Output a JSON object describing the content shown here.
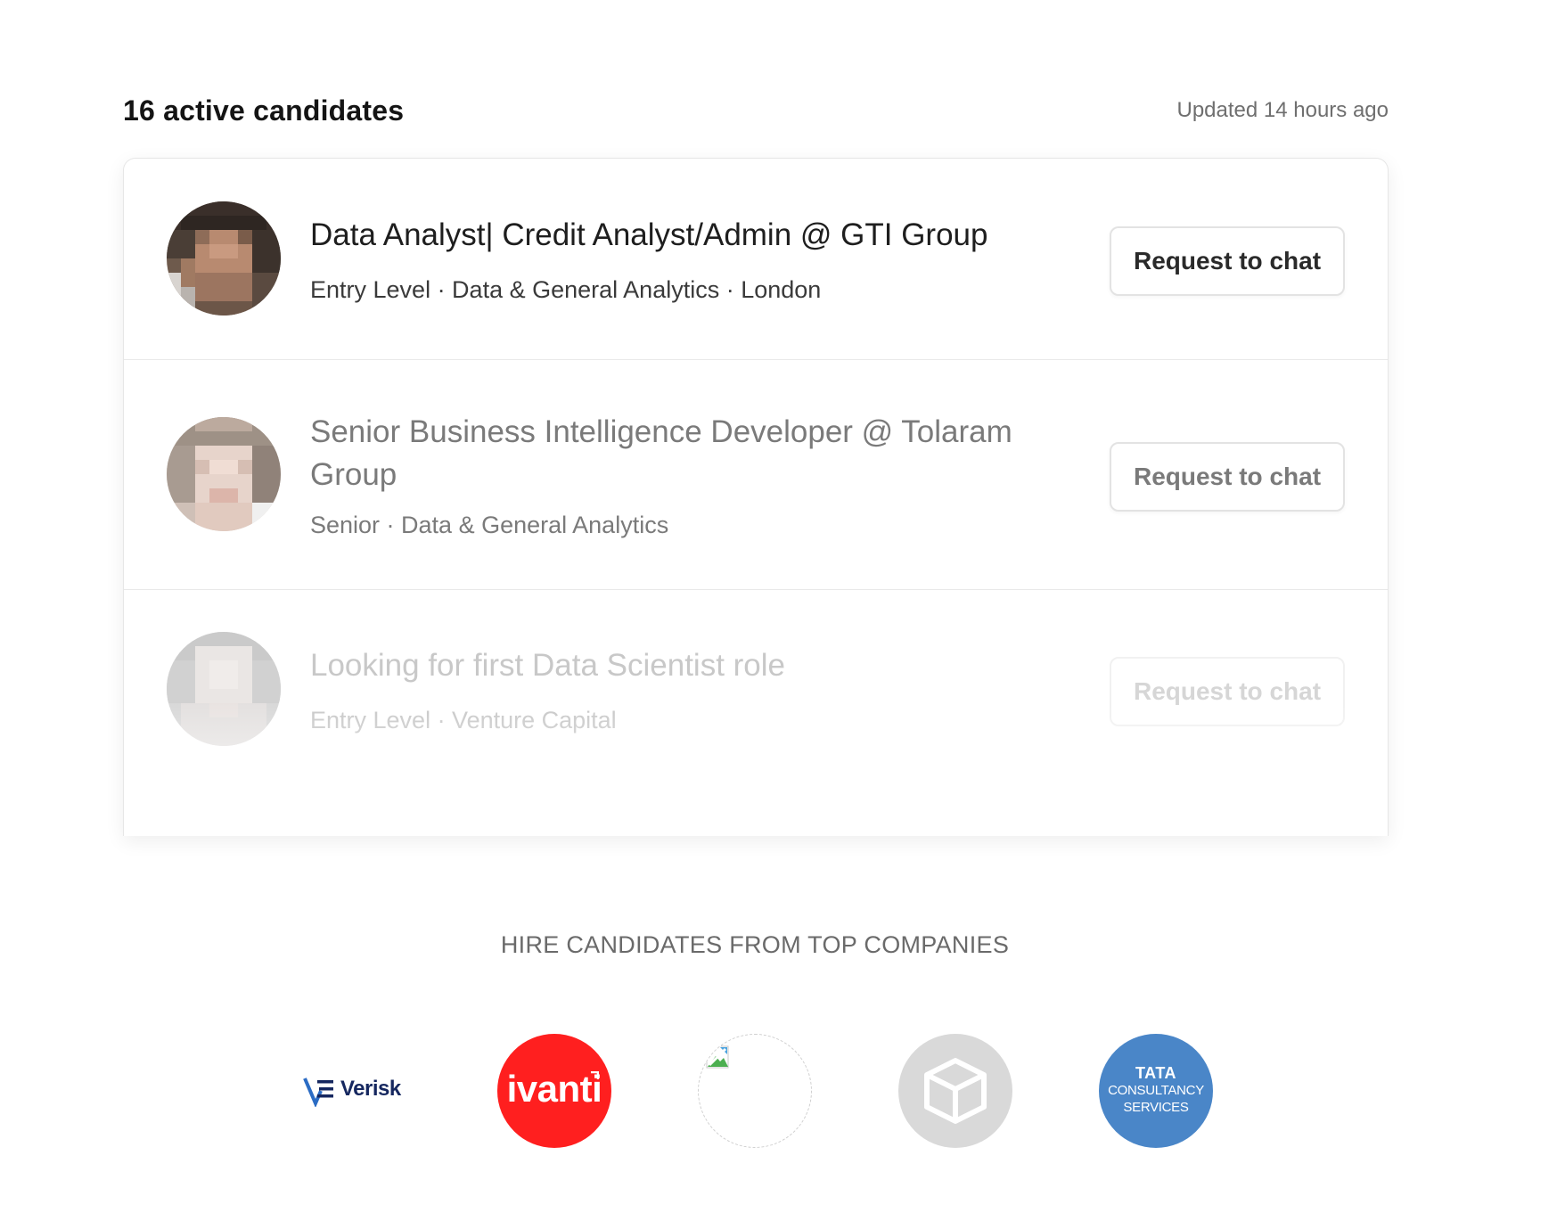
{
  "header": {
    "title": "16 active candidates",
    "updated": "Updated 14 hours ago"
  },
  "candidates": [
    {
      "title": "Data Analyst| Credit Analyst/Admin @ GTI Group",
      "meta": "Entry Level · Data & General Analytics · London",
      "button_label": "Request to chat"
    },
    {
      "title": "Senior Business Intelligence Developer @ Tolaram Group",
      "meta": "Senior · Data & General Analytics",
      "button_label": "Request to chat"
    },
    {
      "title": "Looking for first Data Scientist role",
      "meta": "Entry Level · Venture Capital",
      "button_label": "Request to chat"
    }
  ],
  "companies": {
    "section_title": "HIRE CANDIDATES FROM TOP COMPANIES",
    "logos": [
      {
        "name": "Verisk",
        "icon": "verisk-logo"
      },
      {
        "name": "ivanti",
        "icon": "ivanti-logo"
      },
      {
        "name": "",
        "icon": "broken-image-icon"
      },
      {
        "name": "",
        "icon": "cube-placeholder-icon"
      },
      {
        "name": "TATA CONSULTANCY SERVICES",
        "lines": [
          "TATA",
          "CONSULTANCY",
          "SERVICES"
        ],
        "icon": "tcs-logo"
      }
    ]
  },
  "colors": {
    "ivanti_red": "#ff1f1f",
    "tcs_blue": "#4a86c8",
    "verisk_navy": "#15275f",
    "placeholder_gray": "#d9d9d9"
  }
}
